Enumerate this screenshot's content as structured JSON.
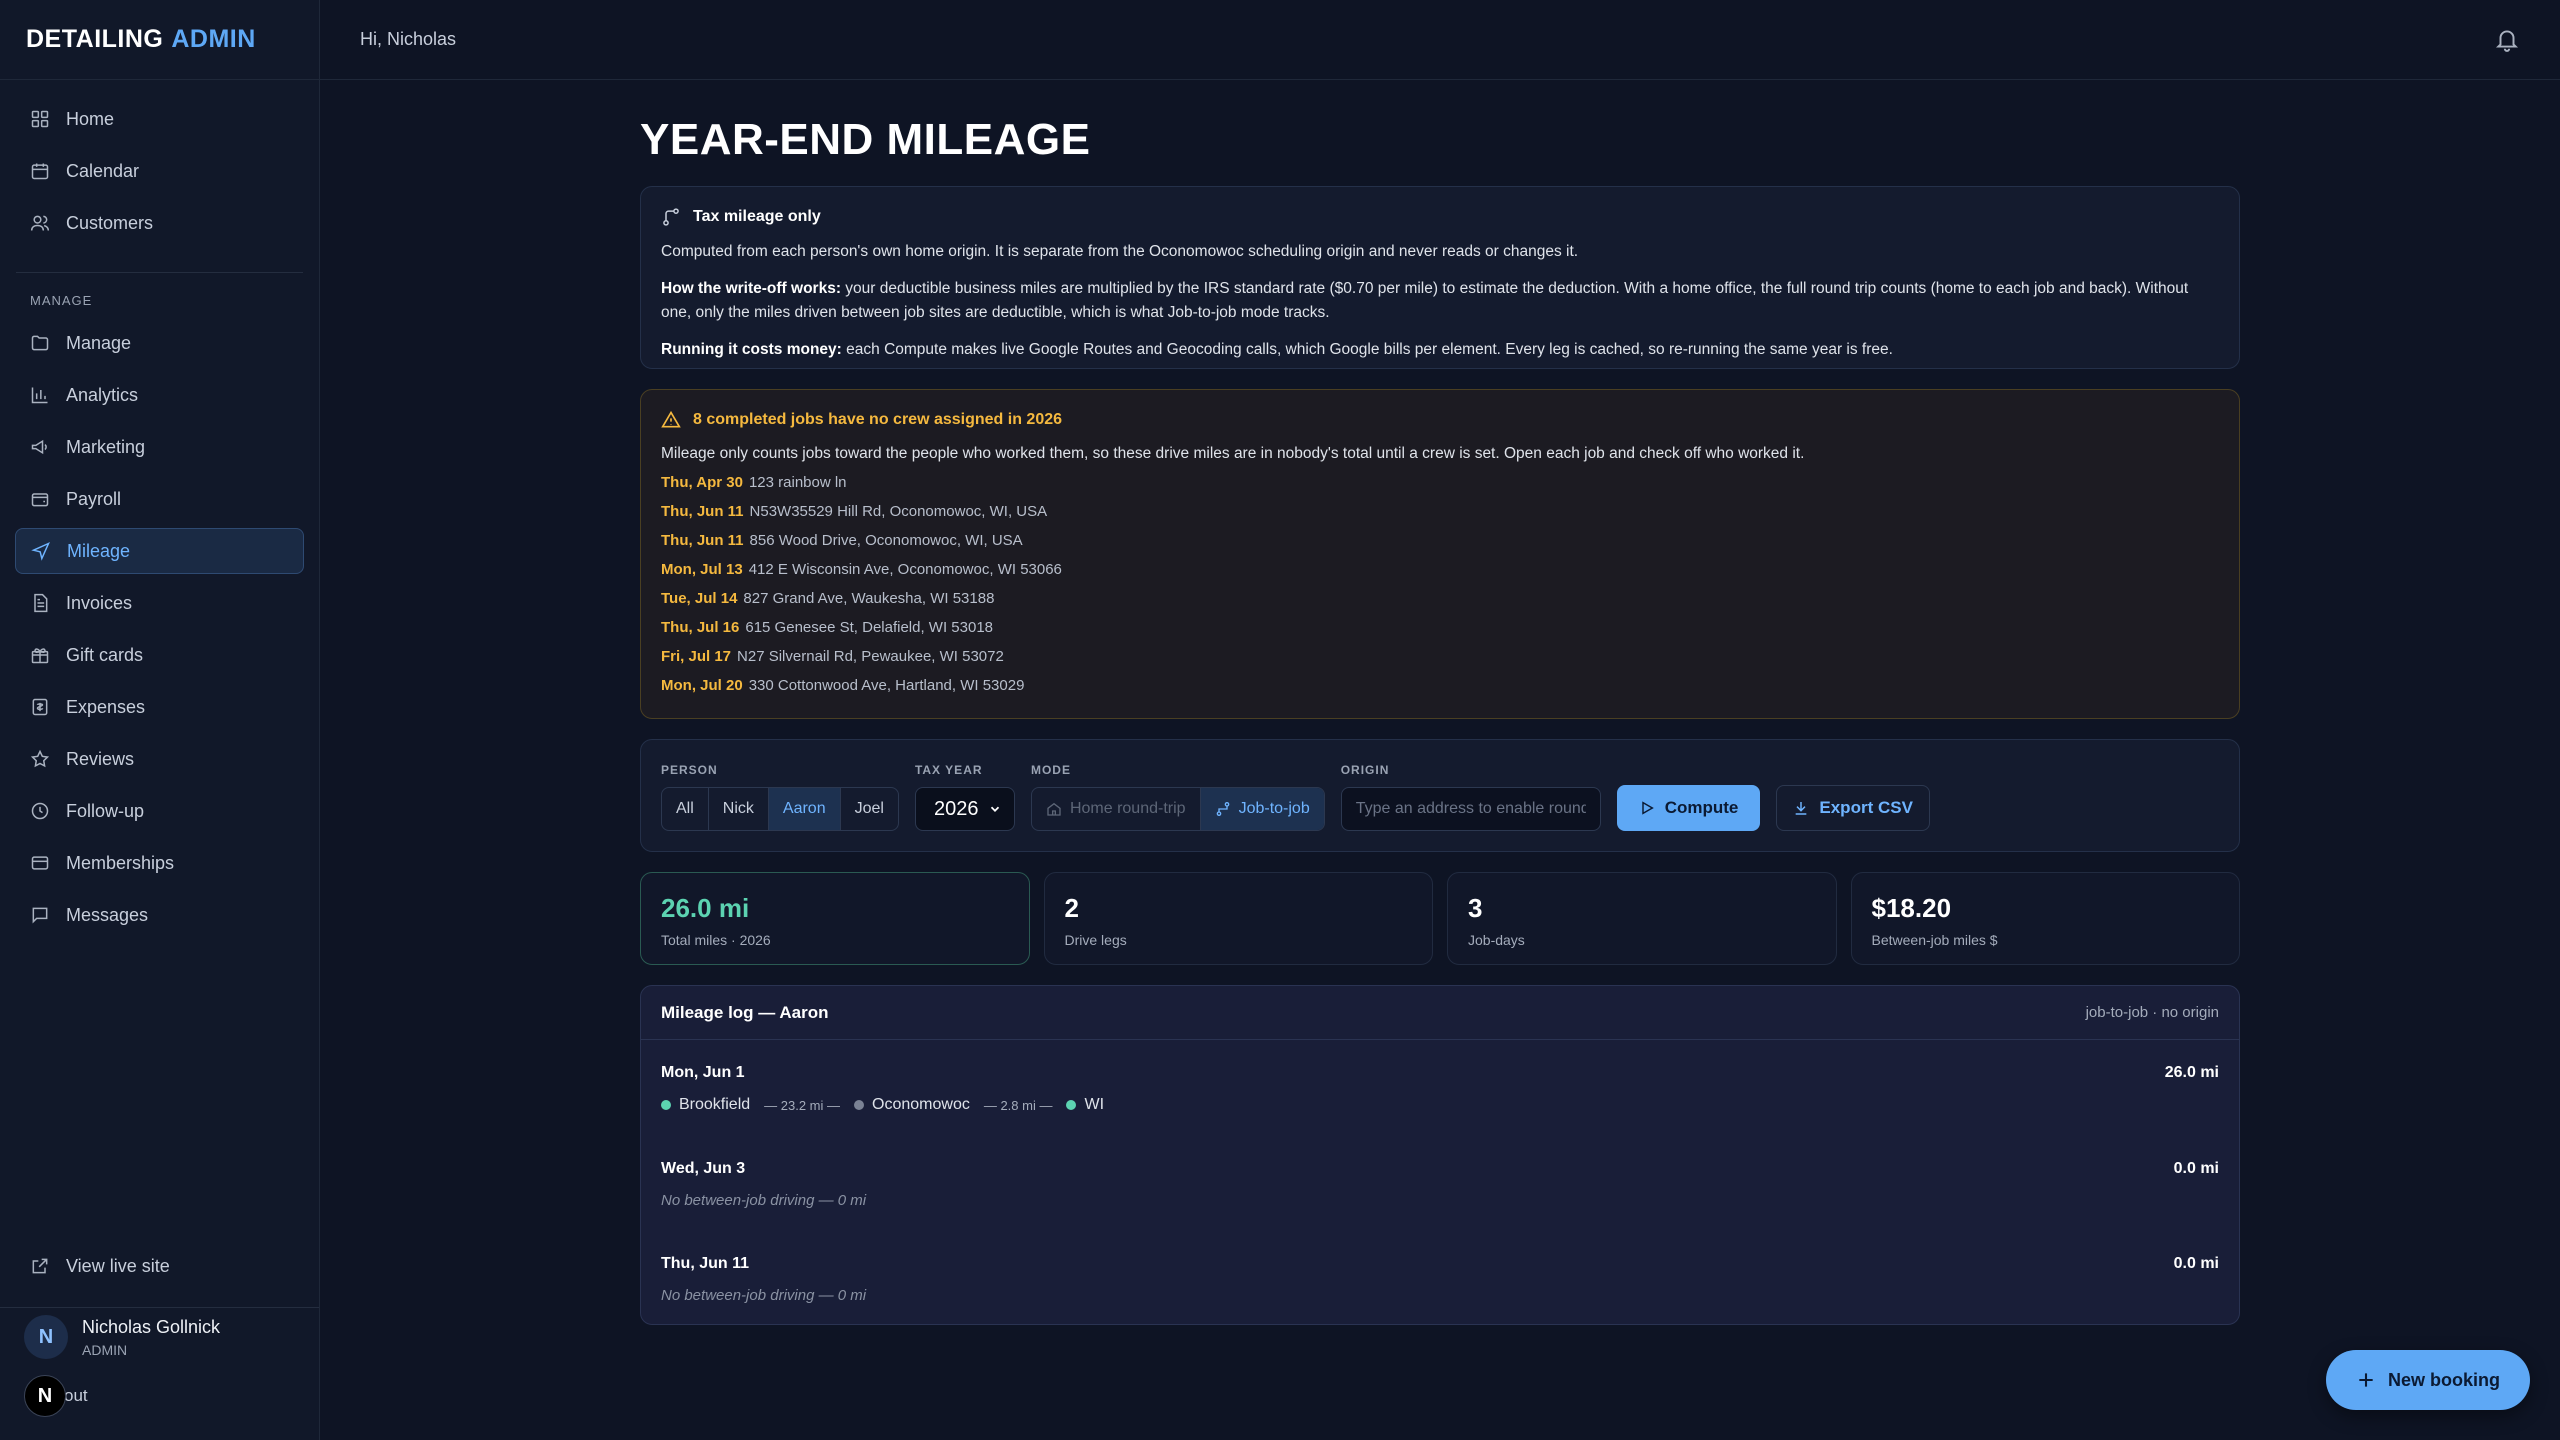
{
  "brand": {
    "part1": "DETAILING",
    "part2": "ADMIN"
  },
  "topbar": {
    "greeting": "Hi, Nicholas"
  },
  "nav": {
    "top_items": [
      {
        "label": "Home",
        "icon": "grid-icon"
      },
      {
        "label": "Calendar",
        "icon": "calendar-icon"
      },
      {
        "label": "Customers",
        "icon": "users-icon"
      }
    ],
    "section_label": "MANAGE",
    "manage_items": [
      {
        "label": "Manage",
        "icon": "folder-icon"
      },
      {
        "label": "Analytics",
        "icon": "bar-chart-icon"
      },
      {
        "label": "Marketing",
        "icon": "megaphone-icon"
      },
      {
        "label": "Payroll",
        "icon": "wallet-icon"
      },
      {
        "label": "Mileage",
        "icon": "navigation-icon",
        "active": true
      },
      {
        "label": "Invoices",
        "icon": "file-icon"
      },
      {
        "label": "Gift cards",
        "icon": "gift-icon"
      },
      {
        "label": "Expenses",
        "icon": "receipt-icon"
      },
      {
        "label": "Reviews",
        "icon": "star-icon"
      },
      {
        "label": "Follow-up",
        "icon": "clock-icon"
      },
      {
        "label": "Memberships",
        "icon": "card-icon"
      },
      {
        "label": "Messages",
        "icon": "message-icon"
      }
    ],
    "view_live": "View live site"
  },
  "user": {
    "initial": "N",
    "name": "Nicholas Gollnick",
    "role": "ADMIN",
    "logout_badge": "N",
    "logout_label": "out"
  },
  "page": {
    "title": "YEAR-END MILEAGE"
  },
  "info": {
    "heading": "Tax mileage only",
    "line1": "Computed from each person's own home origin. It is separate from the Oconomowoc scheduling origin and never reads or changes it.",
    "line2_bold": "How the write-off works:",
    "line2": " your deductible business miles are multiplied by the IRS standard rate ($0.70 per mile) to estimate the deduction. With a home office, the full round trip counts (home to each job and back). Without one, only the miles driven between job sites are deductible, which is what Job-to-job mode tracks.",
    "line3_bold": "Running it costs money:",
    "line3": " each Compute makes live Google Routes and Geocoding calls, which Google bills per element. Every leg is cached, so re-running the same year is free."
  },
  "warning": {
    "heading": "8 completed jobs have no crew assigned in 2026",
    "desc": "Mileage only counts jobs toward the people who worked them, so these drive miles are in nobody's total until a crew is set. Open each job and check off who worked it.",
    "jobs": [
      {
        "date": "Thu, Apr 30",
        "address": "123 rainbow ln"
      },
      {
        "date": "Thu, Jun 11",
        "address": "N53W35529 Hill Rd, Oconomowoc, WI, USA"
      },
      {
        "date": "Thu, Jun 11",
        "address": "856 Wood Drive, Oconomowoc, WI, USA"
      },
      {
        "date": "Mon, Jul 13",
        "address": "412 E Wisconsin Ave, Oconomowoc, WI 53066"
      },
      {
        "date": "Tue, Jul 14",
        "address": "827 Grand Ave, Waukesha, WI 53188"
      },
      {
        "date": "Thu, Jul 16",
        "address": "615 Genesee St, Delafield, WI 53018"
      },
      {
        "date": "Fri, Jul 17",
        "address": "N27 Silvernail Rd, Pewaukee, WI 53072"
      },
      {
        "date": "Mon, Jul 20",
        "address": "330 Cottonwood Ave, Hartland, WI 53029"
      }
    ]
  },
  "controls": {
    "person_label": "PERSON",
    "persons": [
      "All",
      "Nick",
      "Aaron",
      "Joel"
    ],
    "selected_person": "Aaron",
    "year_label": "TAX YEAR",
    "year": "2026",
    "mode_label": "MODE",
    "mode_home": "Home round-trip",
    "mode_job": "Job-to-job",
    "origin_label": "ORIGIN",
    "origin_placeholder": "Type an address to enable round-trip",
    "compute": "Compute",
    "export": "Export CSV"
  },
  "stats": [
    {
      "value": "26.0 mi",
      "caption": "Total miles · 2026"
    },
    {
      "value": "2",
      "caption": "Drive legs"
    },
    {
      "value": "3",
      "caption": "Job-days"
    },
    {
      "value": "$18.20",
      "caption": "Between-job miles $"
    }
  ],
  "log": {
    "title": "Mileage log — Aaron",
    "meta": "job-to-job · no origin",
    "days": [
      {
        "date": "Mon, Jun 1",
        "total": "26.0 mi",
        "stops": [
          "Brookfield",
          "Oconomowoc",
          "WI"
        ],
        "legs": [
          "— 23.2 mi —",
          "— 2.8 mi —"
        ]
      },
      {
        "date": "Wed, Jun 3",
        "total": "0.0 mi",
        "empty": "No between-job driving — 0 mi"
      },
      {
        "date": "Thu, Jun 11",
        "total": "0.0 mi",
        "empty": "No between-job driving — 0 mi"
      }
    ]
  },
  "fab": {
    "label": "New booking"
  }
}
